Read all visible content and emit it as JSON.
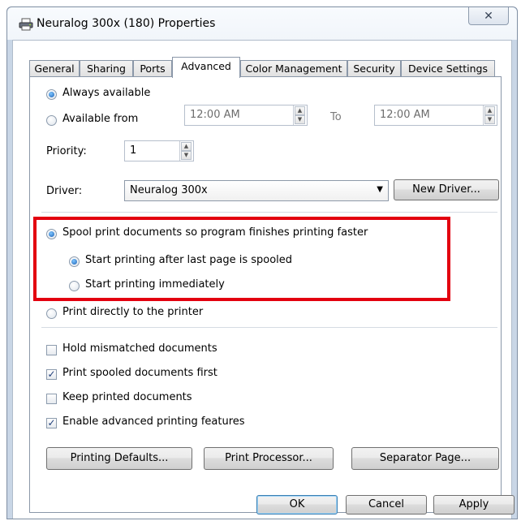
{
  "window": {
    "title": "Neuralog 300x (180) Properties",
    "close_label": "✕"
  },
  "tabs": [
    {
      "label": "General"
    },
    {
      "label": "Sharing"
    },
    {
      "label": "Ports"
    },
    {
      "label": "Advanced",
      "active": true
    },
    {
      "label": "Color Management"
    },
    {
      "label": "Security"
    },
    {
      "label": "Device Settings"
    }
  ],
  "availability": {
    "always_label": "Always available",
    "from_label": "Available from",
    "from_time": "12:00 AM",
    "to_label": "To",
    "to_time": "12:00 AM",
    "selected": "always"
  },
  "priority": {
    "label": "Priority:",
    "value": "1"
  },
  "driver": {
    "label": "Driver:",
    "value": "Neuralog 300x",
    "new_driver_label": "New Driver..."
  },
  "spool": {
    "spool_label": "Spool print documents so program finishes printing faster",
    "after_last_label": "Start printing after last page is spooled",
    "immediately_label": "Start printing immediately",
    "direct_label": "Print directly to the printer",
    "selected": "spool",
    "sub_selected": "after_last"
  },
  "options": [
    {
      "label": "Hold mismatched documents",
      "checked": false
    },
    {
      "label": "Print spooled documents first",
      "checked": true
    },
    {
      "label": "Keep printed documents",
      "checked": false
    },
    {
      "label": "Enable advanced printing features",
      "checked": true
    }
  ],
  "bottom_buttons": {
    "defaults": "Printing Defaults...",
    "processor": "Print Processor...",
    "separator": "Separator Page..."
  },
  "dialog_buttons": {
    "ok": "OK",
    "cancel": "Cancel",
    "apply": "Apply"
  },
  "colors": {
    "highlight_box": "#e3000f",
    "radio_fill": "#1a5fb4"
  }
}
